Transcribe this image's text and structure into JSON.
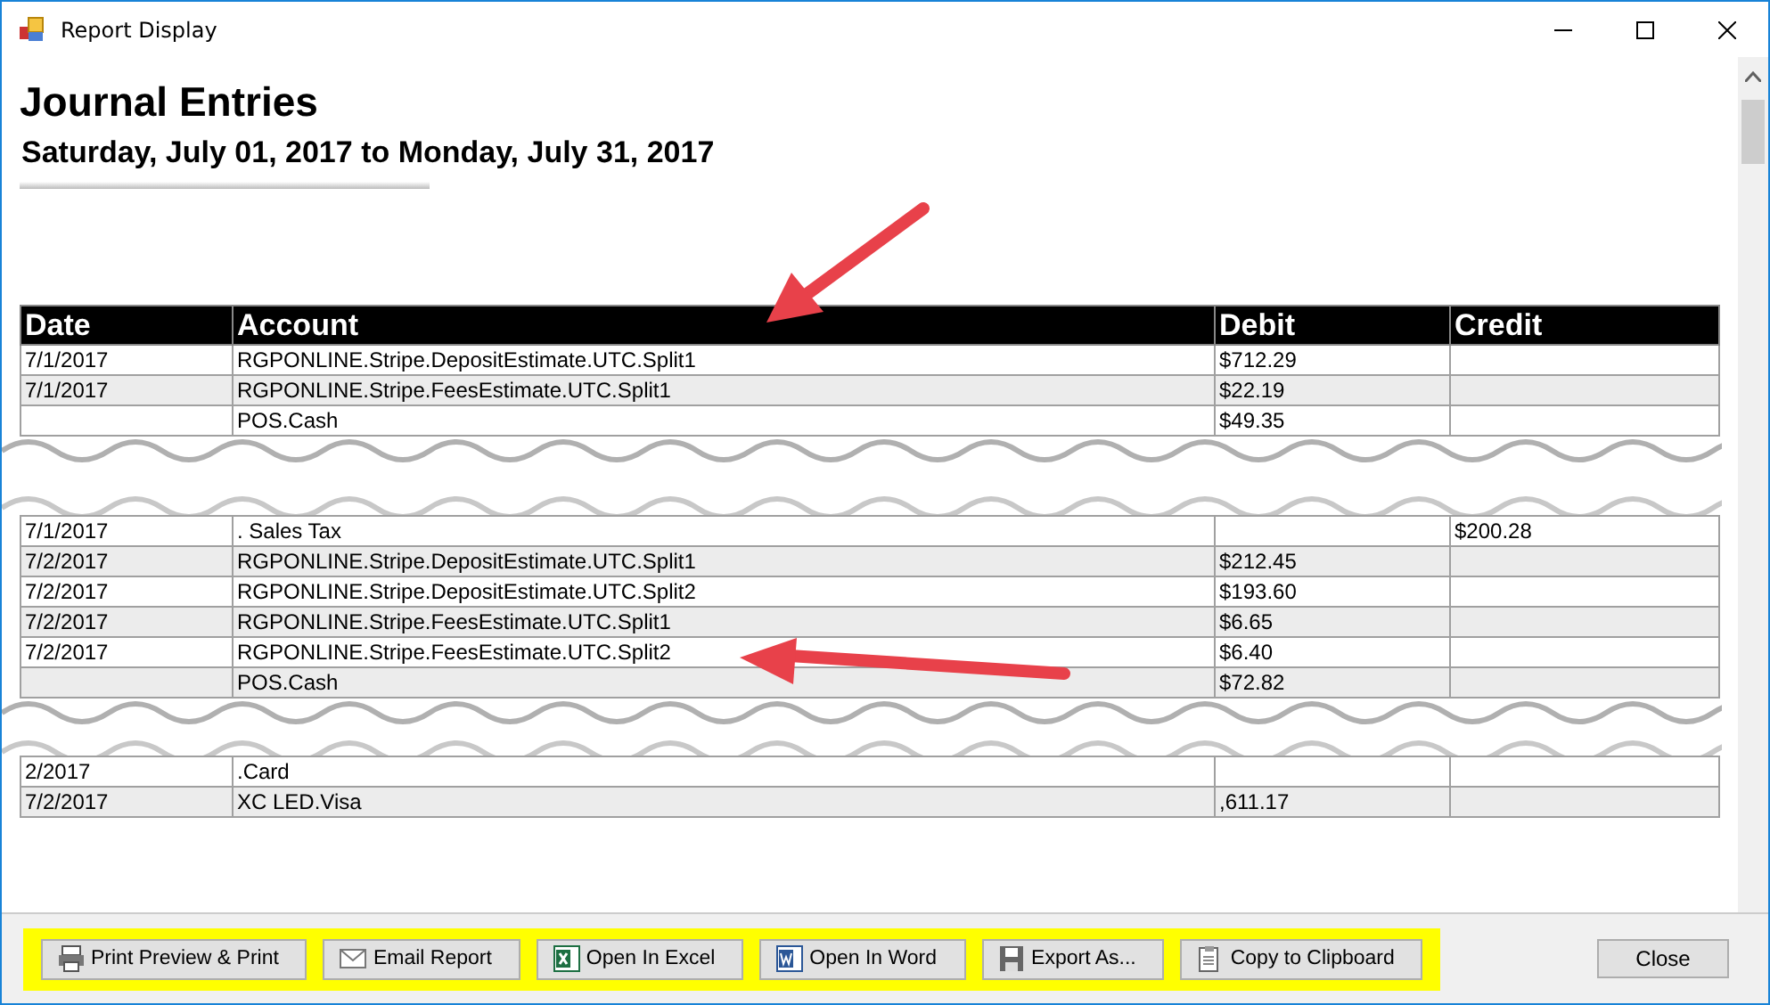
{
  "window": {
    "title": "Report Display"
  },
  "report": {
    "title": "Journal Entries",
    "subtitle": "Saturday, July 01, 2017 to Monday, July 31, 2017"
  },
  "table": {
    "columns": [
      "Date",
      "Account",
      "Debit",
      "Credit"
    ],
    "segments": [
      {
        "rows": [
          {
            "date": "7/1/2017",
            "account": "RGPONLINE.Stripe.DepositEstimate.UTC.Split1",
            "debit": "$712.29"
          },
          {
            "date": "7/1/2017",
            "account": "RGPONLINE.Stripe.FeesEstimate.UTC.Split1",
            "debit": "$22.19"
          },
          {
            "account": "POS.Cash",
            "debit": "$49.35"
          }
        ]
      },
      {
        "rows": [
          {
            "date": "7/1/2017",
            "account": ". Sales Tax",
            "credit": "$200.28"
          },
          {
            "date": "7/2/2017",
            "account": "RGPONLINE.Stripe.DepositEstimate.UTC.Split1",
            "debit": "$212.45"
          },
          {
            "date": "7/2/2017",
            "account": "RGPONLINE.Stripe.DepositEstimate.UTC.Split2",
            "debit": "$193.60"
          },
          {
            "date": "7/2/2017",
            "account": "RGPONLINE.Stripe.FeesEstimate.UTC.Split1",
            "debit": "$6.65"
          },
          {
            "date": "7/2/2017",
            "account": "RGPONLINE.Stripe.FeesEstimate.UTC.Split2",
            "debit": "$6.40"
          },
          {
            "account": "POS.Cash",
            "debit": "$72.82"
          }
        ]
      },
      {
        "rows": [
          {
            "date": "2/2017",
            "account": ".Card"
          },
          {
            "date": "7/2/2017",
            "account": "XC LED.Visa",
            "debit": ",611.17"
          }
        ]
      }
    ]
  },
  "toolbar": {
    "buttons": [
      {
        "kind": "print",
        "label": "Print Preview & Print"
      },
      {
        "kind": "email",
        "label": "Email Report"
      },
      {
        "kind": "excel",
        "label": "Open In Excel"
      },
      {
        "kind": "word",
        "label": "Open In Word"
      },
      {
        "kind": "save",
        "label": "Export As..."
      },
      {
        "kind": "clipboard",
        "label": "Copy to Clipboard"
      }
    ]
  },
  "close_button": {
    "label": "Close"
  }
}
